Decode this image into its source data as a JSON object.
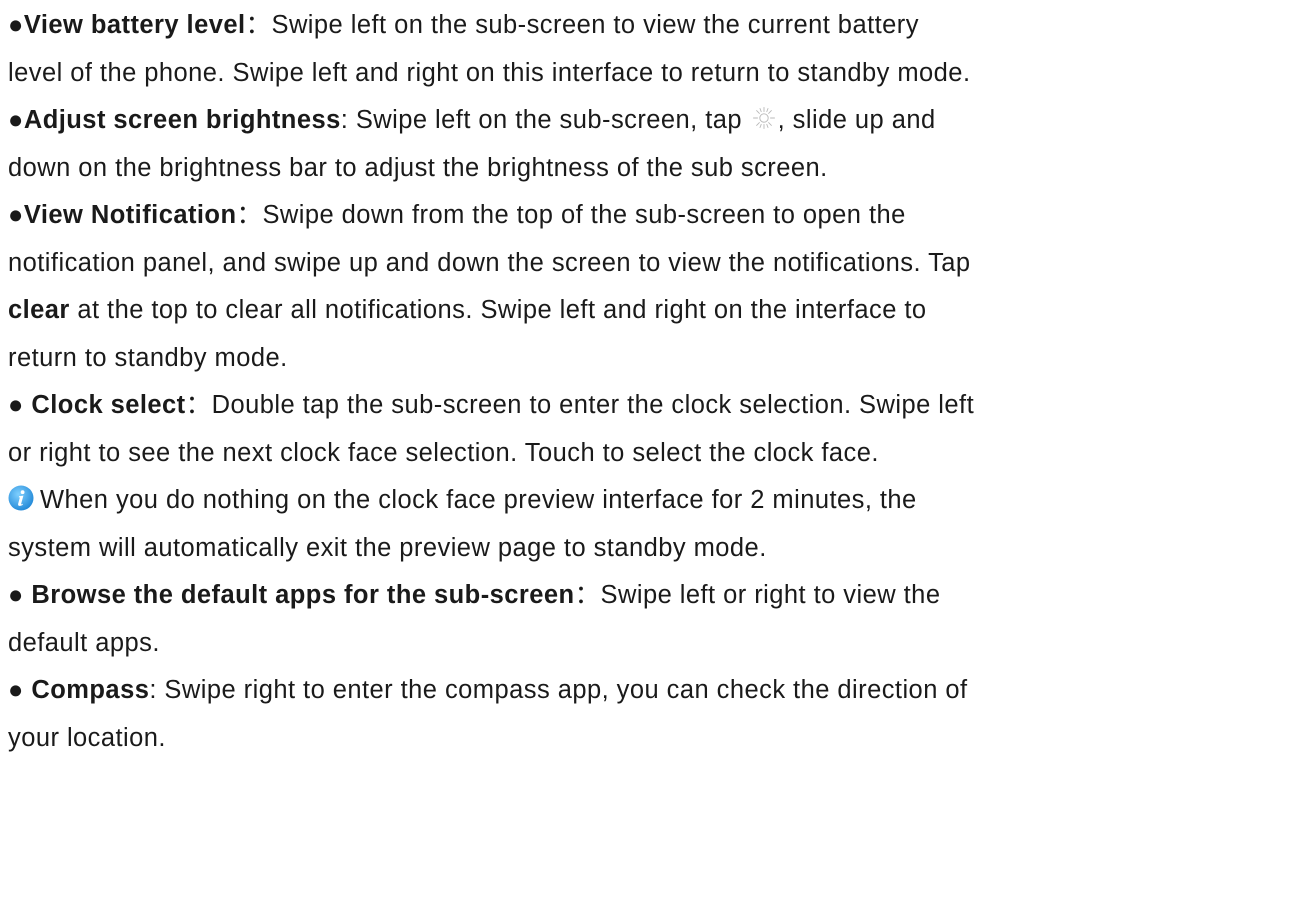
{
  "sections": {
    "battery": {
      "bullet": "●",
      "title": "View battery level",
      "sep": "：",
      "line1_rest": "Swipe left on the sub-screen to view the current battery",
      "line2": "level of the phone. Swipe left and right on this interface to return to standby mode."
    },
    "brightness": {
      "bullet": "●",
      "title": "Adjust screen brightness",
      "sep": ": ",
      "line1_a": "Swipe left on the sub-screen, tap ",
      "icon": "sun-brightness-icon",
      "line1_b": ", slide up and",
      "line2": "down on the brightness bar to adjust the brightness of the sub screen."
    },
    "notification": {
      "bullet": "●",
      "title": "View Notification",
      "sep": "：",
      "line1_rest": "Swipe down from the top of the sub-screen to open the",
      "line2": "notification panel, and swipe up and down the screen to view the notifications. Tap",
      "line3_bold": "clear",
      "line3_rest": " at the top to clear all notifications. Swipe left and right on the interface to",
      "line4": "return to standby mode."
    },
    "clock": {
      "bullet": "● ",
      "title": "Clock select",
      "sep": "：",
      "line1_rest": "Double tap the sub-screen to enter the clock selection. Swipe left",
      "line2": "or right to see the next clock face selection. Touch to select the clock face."
    },
    "note": {
      "icon": "info-icon",
      "icon_color": "#2d9be8",
      "line1": "When you do nothing on the clock face preview interface for 2 minutes, the",
      "line2": "system will automatically exit the preview page to standby mode."
    },
    "apps": {
      "bullet": "● ",
      "title": "Browse the default apps for the sub-screen",
      "sep": "：",
      "line1_rest": "Swipe left or right to view the",
      "line2": "default apps."
    },
    "compass": {
      "bullet": "● ",
      "title": "Compass",
      "sep": ": ",
      "line1_rest": "Swipe right to enter the compass app, you can check the direction of",
      "line2": "your location."
    }
  }
}
